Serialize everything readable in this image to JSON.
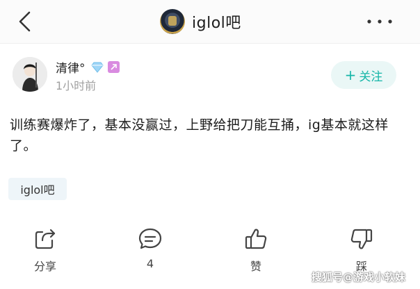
{
  "header": {
    "title": "iglol吧",
    "back_icon": "chevron-left-icon",
    "more_icon": "more-dots-icon"
  },
  "post": {
    "author": {
      "name": "清律°",
      "badges": [
        "diamond-icon",
        "level-badge-icon"
      ]
    },
    "time": "1小时前",
    "follow_label": "关注",
    "follow_icon": "plus",
    "content": "训练赛爆炸了，基本没赢过，上野给把刀能互捅，ig基本就这样了。",
    "tag": "iglol吧"
  },
  "actions": [
    {
      "label": "分享",
      "icon": "share-icon"
    },
    {
      "label": "4",
      "icon": "comment-icon"
    },
    {
      "label": "赞",
      "icon": "thumbs-up-icon"
    },
    {
      "label": "踩",
      "icon": "thumbs-down-icon"
    }
  ],
  "watermark": "搜狐号@游戏小软妹",
  "colors": {
    "accent": "#17b6a8",
    "follow_bg": "#eaf7f6",
    "tag_bg": "#eef5f9",
    "muted": "#a0a0a0"
  }
}
